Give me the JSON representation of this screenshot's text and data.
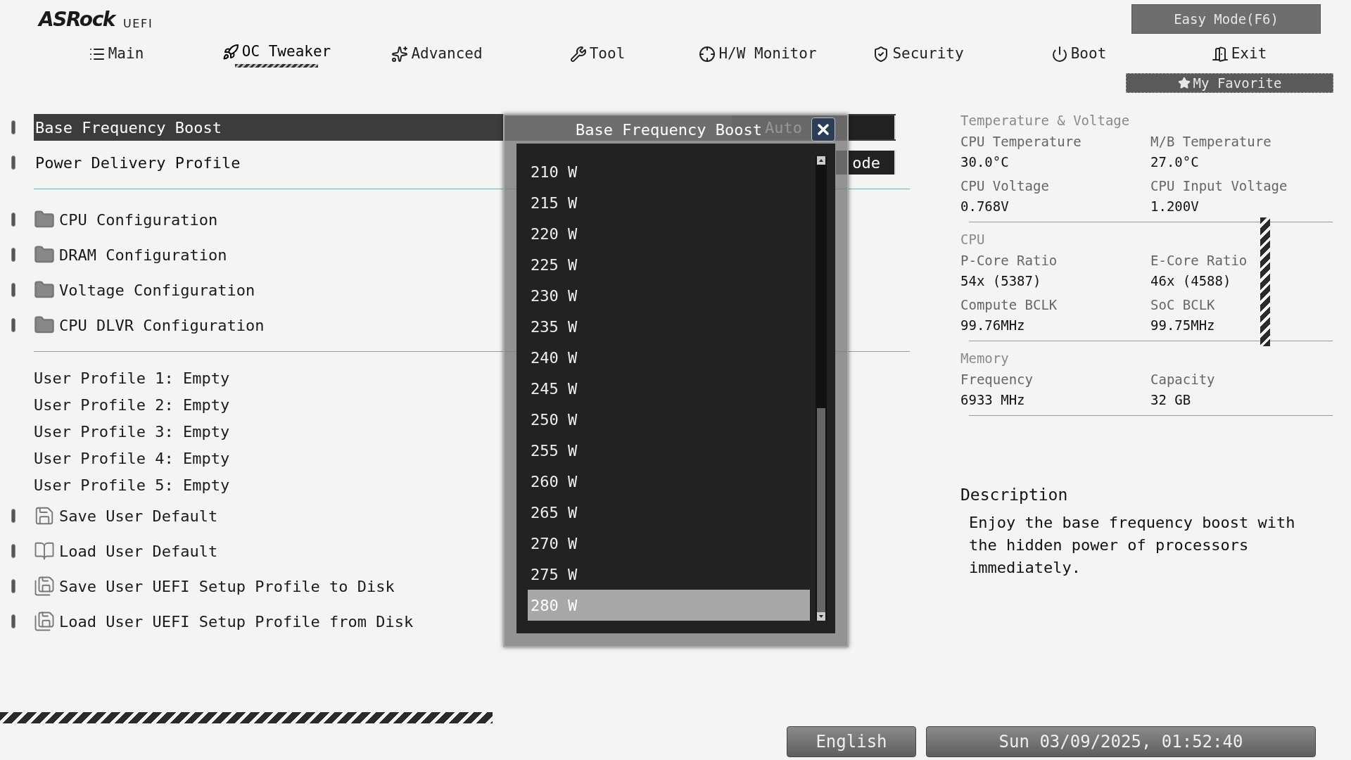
{
  "header": {
    "logo": "ASRock",
    "logo_suffix": "UEFI",
    "easy_mode": "Easy Mode(F6)",
    "favorite": "My Favorite"
  },
  "tabs": [
    {
      "label": "Main",
      "kind": "list",
      "selected": false
    },
    {
      "label": "OC Tweaker",
      "kind": "rocket",
      "selected": true
    },
    {
      "label": "Advanced",
      "kind": "star",
      "selected": false
    },
    {
      "label": "Tool",
      "kind": "wrench",
      "selected": false
    },
    {
      "label": "H/W Monitor",
      "kind": "crosshair",
      "selected": false
    },
    {
      "label": "Security",
      "kind": "shield",
      "selected": false
    },
    {
      "label": "Boot",
      "kind": "power",
      "selected": false
    },
    {
      "label": "Exit",
      "kind": "door",
      "selected": false
    }
  ],
  "settings": [
    {
      "label": "Base Frequency Boost",
      "value": "Auto",
      "selected": true
    },
    {
      "label": "Power Delivery Profile",
      "value": "ode",
      "selected": false
    }
  ],
  "submenus": [
    {
      "label": "CPU Configuration"
    },
    {
      "label": "DRAM Configuration"
    },
    {
      "label": "Voltage Configuration"
    },
    {
      "label": "CPU DLVR Configuration"
    }
  ],
  "profiles": [
    "User Profile 1: Empty",
    "User Profile 2: Empty",
    "User Profile 3: Empty",
    "User Profile 4: Empty",
    "User Profile 5: Empty"
  ],
  "actions": [
    {
      "label": "Save User Default",
      "kind": "save"
    },
    {
      "label": "Load User Default",
      "kind": "load"
    },
    {
      "label": "Save User UEFI Setup Profile to Disk",
      "kind": "disk"
    },
    {
      "label": "Load User UEFI Setup Profile from Disk",
      "kind": "disk"
    }
  ],
  "dialog": {
    "title": "Base Frequency Boost",
    "options": [
      {
        "label": "210 W",
        "selected": false
      },
      {
        "label": "215 W",
        "selected": false
      },
      {
        "label": "220 W",
        "selected": false
      },
      {
        "label": "225 W",
        "selected": false
      },
      {
        "label": "230 W",
        "selected": false
      },
      {
        "label": "235 W",
        "selected": false
      },
      {
        "label": "240 W",
        "selected": false
      },
      {
        "label": "245 W",
        "selected": false
      },
      {
        "label": "250 W",
        "selected": false
      },
      {
        "label": "255 W",
        "selected": false
      },
      {
        "label": "260 W",
        "selected": false
      },
      {
        "label": "265 W",
        "selected": false
      },
      {
        "label": "270 W",
        "selected": false
      },
      {
        "label": "275 W",
        "selected": false
      },
      {
        "label": "280 W",
        "selected": true
      }
    ]
  },
  "monitor": [
    {
      "title": "Temperature & Voltage",
      "items": [
        {
          "label": "CPU Temperature",
          "value": "30.0°C"
        },
        {
          "label": "M/B Temperature",
          "value": "27.0°C"
        },
        {
          "label": "CPU Voltage",
          "value": "0.768V"
        },
        {
          "label": "CPU Input Voltage",
          "value": "1.200V"
        }
      ]
    },
    {
      "title": "CPU",
      "items": [
        {
          "label": "P-Core Ratio",
          "value": "54x (5387)"
        },
        {
          "label": "E-Core Ratio",
          "value": "46x (4588)"
        },
        {
          "label": "Compute BCLK",
          "value": "99.76MHz"
        },
        {
          "label": "SoC BCLK",
          "value": "99.75MHz"
        }
      ]
    },
    {
      "title": "Memory",
      "items": [
        {
          "label": "Frequency",
          "value": "6933 MHz"
        },
        {
          "label": "Capacity",
          "value": "32 GB"
        }
      ]
    }
  ],
  "description": {
    "title": "Description",
    "text": "Enjoy the base frequency boost with the hidden power of processors immediately."
  },
  "footer": {
    "language": "English",
    "datetime": "Sun 03/09/2025, 01:52:40"
  }
}
